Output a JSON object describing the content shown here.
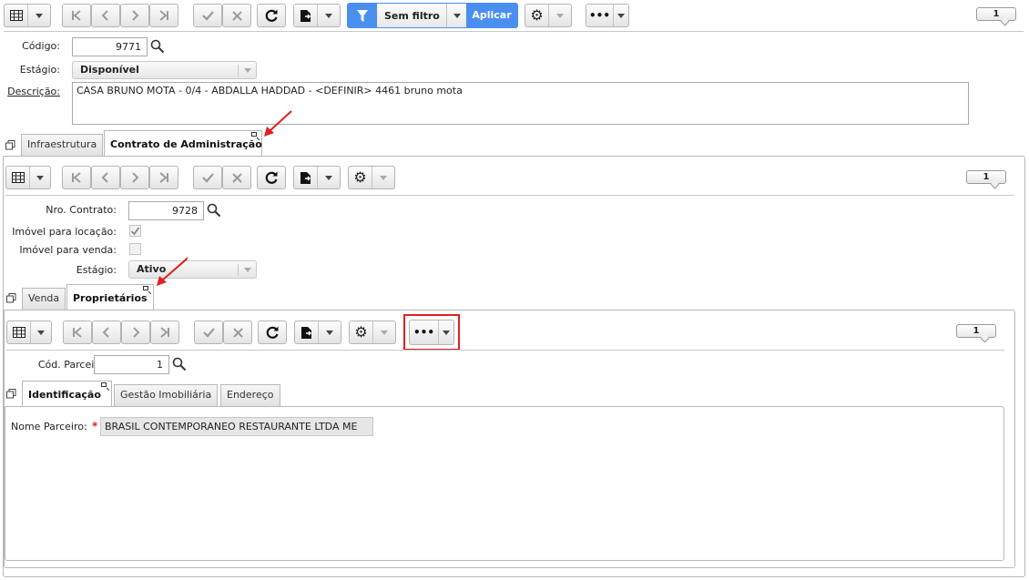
{
  "toolbar": {
    "filter_label": "Sem filtro",
    "apply_label": "Aplicar",
    "record_count": "1"
  },
  "form": {
    "codigo_label": "Código:",
    "codigo_value": "9771",
    "estagio_label": "Estágio:",
    "estagio_value": "Disponível",
    "descricao_label": "Descrição:",
    "descricao_value": "CASA BRUNO MOTA - 0/4 - ABDALLA HADDAD - <DEFINIR> 4461 bruno mota"
  },
  "tabs_level1": {
    "infra": "Infraestrutura",
    "contrato": "Contrato de Administração"
  },
  "contrato": {
    "record_count": "1",
    "nro_label": "Nro. Contrato:",
    "nro_value": "9728",
    "locacao_label": "Imóvel para locação:",
    "venda_label": "Imóvel para venda:",
    "estagio_label": "Estágio:",
    "estagio_value": "Ativo"
  },
  "tabs_level2": {
    "venda": "Venda",
    "proprietarios": "Proprietários"
  },
  "proprietarios": {
    "record_count": "1",
    "parceiro_label": "Cód. Parceiro:",
    "parceiro_value": "1"
  },
  "tabs_level3": {
    "identificacao": "Identificação",
    "gestao": "Gestão Imobiliária",
    "endereco": "Endereço"
  },
  "identificacao": {
    "nome_label": "Nome Parceiro:",
    "required_mark": "*",
    "nome_value": "BRASIL CONTEMPORANEO RESTAURANTE LTDA ME"
  },
  "colors": {
    "accent_blue": "#4a8ff0",
    "annotation_red": "#e02020"
  }
}
